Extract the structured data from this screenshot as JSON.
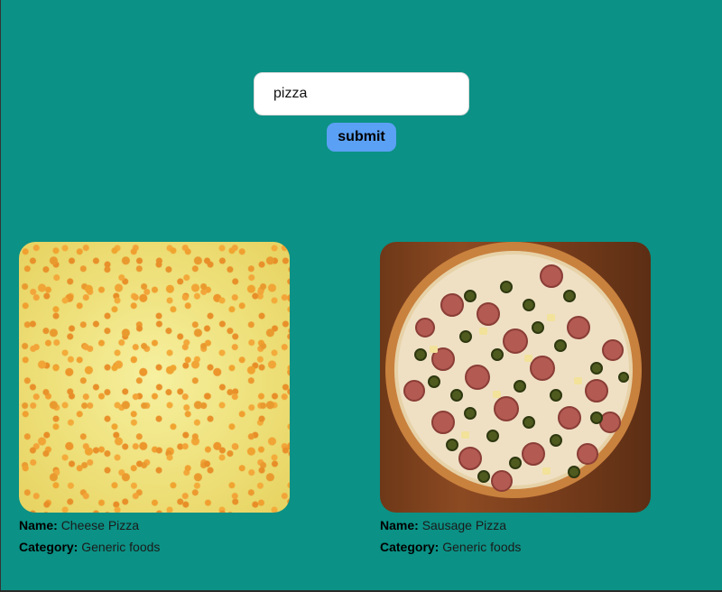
{
  "search": {
    "value": "pizza",
    "submit_label": "submit"
  },
  "results": [
    {
      "image": "cheese-pizza-photo",
      "name_key": "Name:",
      "name_value": "Cheese Pizza",
      "category_key": "Category:",
      "category_value": "Generic foods"
    },
    {
      "image": "sausage-pizza-photo",
      "name_key": "Name:",
      "name_value": "Sausage Pizza",
      "category_key": "Category:",
      "category_value": "Generic foods"
    }
  ],
  "colors": {
    "background": "#0b9185",
    "button": "#5aa0f4",
    "input_background": "#ffffff"
  }
}
